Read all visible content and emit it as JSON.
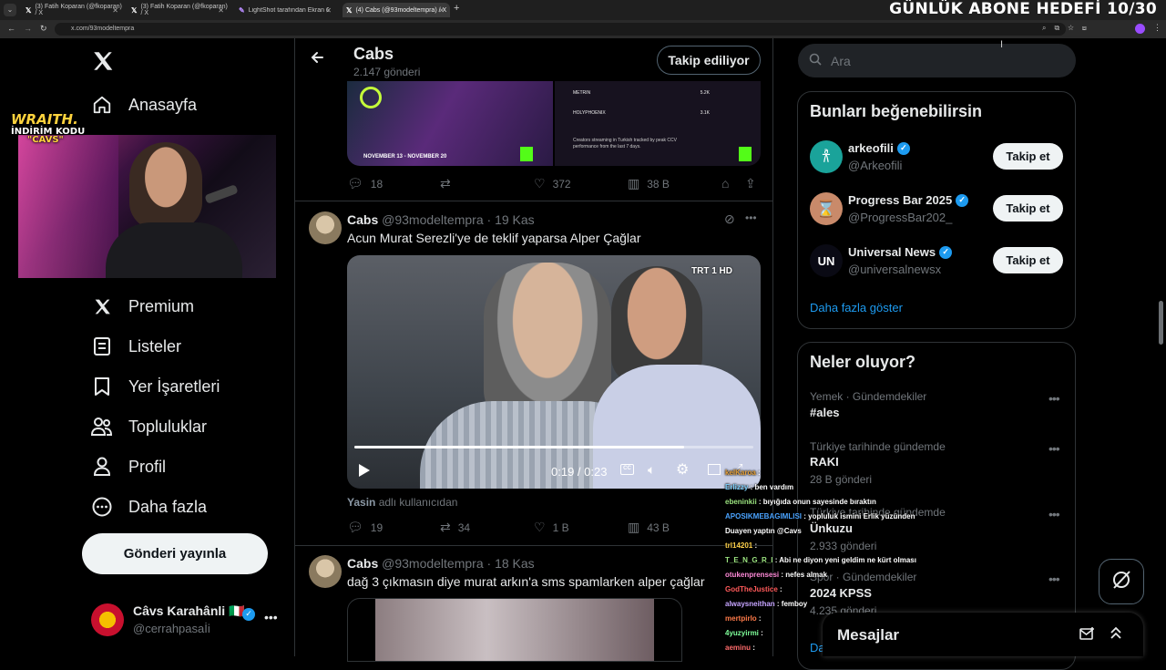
{
  "browser": {
    "tabs": [
      {
        "label": "(3) Fatih Koparan (@fkoparan) / X"
      },
      {
        "label": "(3) Fatih Koparan (@fkoparan) / X"
      },
      {
        "label": "LightShot tarafından Ekran Görüntüsü"
      },
      {
        "label": "(4) Cabs (@93modeltempra) / X"
      }
    ],
    "url": "x.com/93modeltempra",
    "overlay_goal": "GÜNLÜK ABONE HEDEFİ 10/30"
  },
  "stream_overlay": {
    "line1": "WRAITH.",
    "line2": "İNDİRİM KODU",
    "line3": "\"CAVS\""
  },
  "nav": {
    "items": [
      {
        "label": "Anasayfa",
        "icon": "home-icon"
      },
      {
        "label": "Premium",
        "icon": "x-logo-icon"
      },
      {
        "label": "Listeler",
        "icon": "list-icon"
      },
      {
        "label": "Yer İşaretleri",
        "icon": "bookmark-icon"
      },
      {
        "label": "Topluluklar",
        "icon": "communities-icon"
      },
      {
        "label": "Profil",
        "icon": "profile-icon"
      },
      {
        "label": "Daha fazla",
        "icon": "more-circle-icon"
      }
    ],
    "post_button": "Gönderi yayınla",
    "account": {
      "name": "Câvs Karahânli 🇮🇹",
      "handle": "@cerrahpasaİi"
    }
  },
  "profile_header": {
    "name": "Cabs",
    "post_count": "2.147 gönderi",
    "following_button": "Takip ediliyor"
  },
  "tweets": [
    {
      "metrics": {
        "replies": "18",
        "retweets": "",
        "likes": "372",
        "views": "38 B"
      },
      "media_text": {
        "date_range": "NOVEMBER 13 - NOVEMBER 20",
        "caption": "Creators streaming in Turkish tracked by peak CCV performance from the last 7 days.",
        "rows": [
          {
            "name": "METRIN",
            "value": "5.2K"
          },
          {
            "name": "HOLYPHOENIX",
            "value": "3.1K"
          }
        ]
      }
    },
    {
      "name": "Cabs",
      "handle": "@93modeltempra",
      "date": "· 19 Kas",
      "text": "Acun Murat Serezli'ye de teklif yaparsa Alper Çağlar",
      "video": {
        "time": "0:19 / 0:23",
        "watermark": "TRT 1 HD",
        "progress": 0.826
      },
      "attribution_user": "Yasin",
      "attribution_text": "adlı kullanıcıdan",
      "metrics": {
        "replies": "19",
        "retweets": "34",
        "likes": "1 B",
        "views": "43 B"
      }
    },
    {
      "name": "Cabs",
      "handle": "@93modeltempra",
      "date": "· 18 Kas",
      "text": "dağ 3 çıkmasın diye murat arkın'a sms spamlarken alper çağlar"
    }
  ],
  "search": {
    "placeholder": "Ara"
  },
  "suggestions": {
    "title": "Bunları beğenebilirsin",
    "follow_label": "Takip et",
    "items": [
      {
        "name": "arkeofili",
        "handle": "@Arkeofili",
        "avatar_color": "#1aa39a"
      },
      {
        "name": "Progress Bar 2025",
        "handle": "@ProgressBar202_",
        "avatar_color": "#c98a6a"
      },
      {
        "name": "Universal News",
        "handle": "@universalnewsx",
        "avatar_color": "#0a0a14",
        "avatar_text": "UN"
      }
    ],
    "show_more": "Daha fazla göster"
  },
  "trends": {
    "title": "Neler oluyor?",
    "items": [
      {
        "category": "Yemek · Gündemdekiler",
        "name": "#ales",
        "count": ""
      },
      {
        "category": "Türkiye tarihinde gündemde",
        "name": "RAKI",
        "count": "28 B gönderi"
      },
      {
        "category": "Türkiye tarihinde gündemde",
        "name": "Ünkuzu",
        "count": "2.933 gönderi"
      },
      {
        "category": "Spor · Gündemdekiler",
        "name": "2024 KPSS",
        "count": "4.235 gönderi"
      }
    ],
    "show_more_partial": "Da"
  },
  "chat": [
    {
      "user": "kelKaroa",
      "msg": "",
      "color": "#e6a23c"
    },
    {
      "user": "Erlizzy",
      "msg": "ben vardım",
      "color": "#7fd3ff"
    },
    {
      "user": "ebeninkii",
      "msg": "bıyığıda onun sayesinde bıraktın",
      "color": "#9be37f"
    },
    {
      "user": "APOSIKMEBAGIMLISI",
      "msg": "yopluluk ismini Erlik yüzünden",
      "color": "#4aa3ff"
    },
    {
      "user": "",
      "msg": "Duayen yaptın @Cavs",
      "color": "#ffffff"
    },
    {
      "user": "trl14201",
      "msg": "",
      "color": "#ffd24a"
    },
    {
      "user": "T_E_N_G_R_I",
      "msg": "Abi ne diyon yeni geldim ne kürt olması",
      "color": "#9be37f"
    },
    {
      "user": "otukenprensesi",
      "msg": "nefes almak",
      "color": "#ff8ad8"
    },
    {
      "user": "GodTheJustice",
      "msg": "",
      "color": "#ff5a5a"
    },
    {
      "user": "alwaysneithan",
      "msg": "femboy",
      "color": "#c6a4ff"
    },
    {
      "user": "mertpirlo",
      "msg": "",
      "color": "#ff7b4a"
    },
    {
      "user": "4yuzyirmi",
      "msg": "",
      "color": "#7fff9a"
    },
    {
      "user": "aeminu",
      "msg": "",
      "color": "#ff6b6b"
    }
  ],
  "messages_drawer": {
    "title": "Mesajlar"
  },
  "colors": {
    "bg": "#000000",
    "border": "#2f3336",
    "muted": "#71767b",
    "accent": "#1d9bf0"
  }
}
